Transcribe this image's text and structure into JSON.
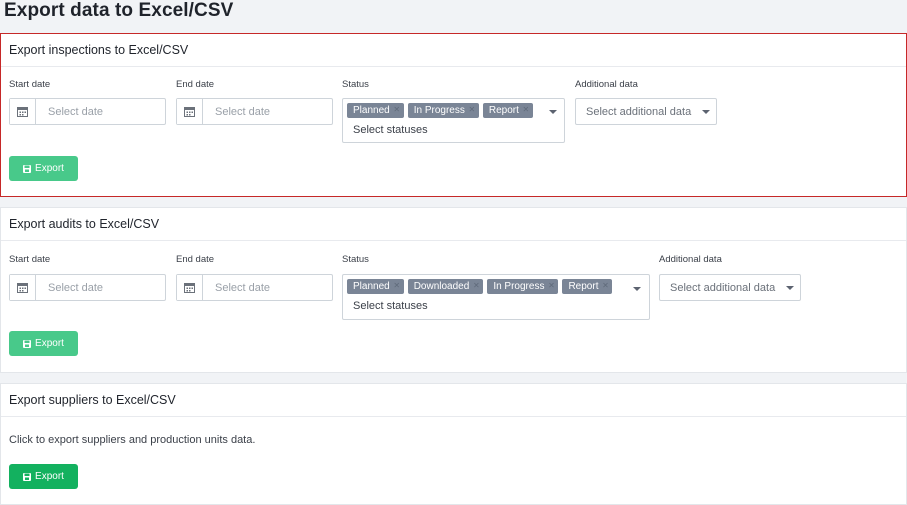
{
  "page": {
    "title": "Export data to Excel/CSV"
  },
  "common": {
    "start_date_label": "Start date",
    "end_date_label": "End date",
    "status_label": "Status",
    "additional_label": "Additional data",
    "date_placeholder": "Select date",
    "status_placeholder": "Select statuses",
    "additional_placeholder": "Select additional data",
    "export_label": "Export"
  },
  "inspections": {
    "title": "Export inspections to Excel/CSV",
    "statuses": [
      "Planned",
      "In Progress",
      "Report"
    ]
  },
  "audits": {
    "title": "Export audits to Excel/CSV",
    "statuses": [
      "Planned",
      "Downloaded",
      "In Progress",
      "Report"
    ]
  },
  "suppliers": {
    "title": "Export suppliers to Excel/CSV",
    "description": "Click to export suppliers and production units data."
  },
  "colors": {
    "highlight_border": "#c62828",
    "chip_bg": "#7a8596",
    "export_light": "#48c98a",
    "export_dark": "#13b15f"
  }
}
